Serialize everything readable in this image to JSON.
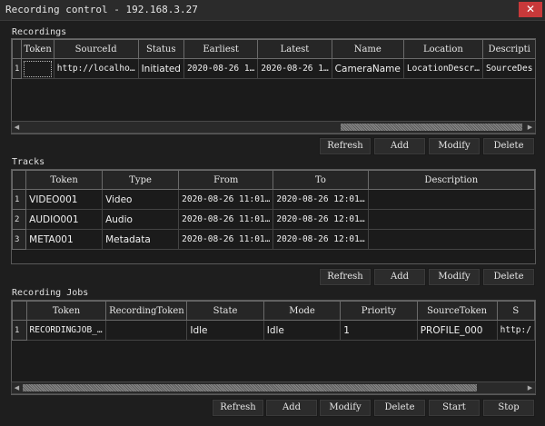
{
  "window": {
    "title": "Recording control - 192.168.3.27",
    "close_glyph": "✕"
  },
  "recordings": {
    "label": "Recordings",
    "columns": [
      "Token",
      "SourceId",
      "Status",
      "Earliest",
      "Latest",
      "Name",
      "Location",
      "Descripti"
    ],
    "rows": [
      {
        "num": "1",
        "cells": [
          "",
          "http://localho…",
          "Initiated",
          "2020-08-26 1…",
          "2020-08-26 1…",
          "CameraName",
          "LocationDescr…",
          "SourceDes"
        ]
      }
    ],
    "buttons": {
      "refresh": "Refresh",
      "add": "Add",
      "modify": "Modify",
      "delete": "Delete"
    }
  },
  "tracks": {
    "label": "Tracks",
    "columns": [
      "Token",
      "Type",
      "From",
      "To",
      "Description"
    ],
    "rows": [
      {
        "num": "1",
        "cells": [
          "VIDEO001",
          "Video",
          "2020-08-26 11:01…",
          "2020-08-26 12:01…",
          ""
        ]
      },
      {
        "num": "2",
        "cells": [
          "AUDIO001",
          "Audio",
          "2020-08-26 11:01…",
          "2020-08-26 12:01…",
          ""
        ]
      },
      {
        "num": "3",
        "cells": [
          "META001",
          "Metadata",
          "2020-08-26 11:01…",
          "2020-08-26 12:01…",
          ""
        ]
      }
    ],
    "buttons": {
      "refresh": "Refresh",
      "add": "Add",
      "modify": "Modify",
      "delete": "Delete"
    }
  },
  "jobs": {
    "label": "Recording Jobs",
    "columns": [
      "Token",
      "RecordingToken",
      "State",
      "Mode",
      "Priority",
      "SourceToken",
      "S"
    ],
    "rows": [
      {
        "num": "1",
        "cells": [
          "RECORDINGJOB_…",
          "",
          "Idle",
          "Idle",
          "1",
          "PROFILE_000",
          "http:/"
        ]
      }
    ],
    "buttons": {
      "refresh": "Refresh",
      "add": "Add",
      "modify": "Modify",
      "delete": "Delete",
      "start": "Start",
      "stop": "Stop"
    }
  },
  "scroll": {
    "left_glyph": "◀",
    "right_glyph": "▶"
  }
}
